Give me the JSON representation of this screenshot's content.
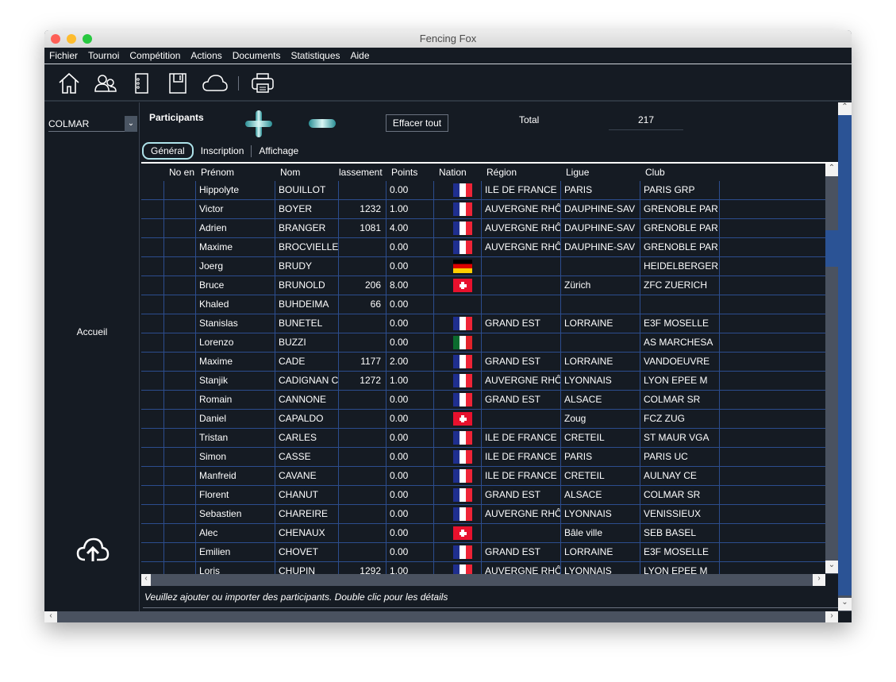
{
  "window": {
    "title": "Fencing Fox"
  },
  "menu": [
    "Fichier",
    "Tournoi",
    "Compétition",
    "Actions",
    "Documents",
    "Statistiques",
    "Aide"
  ],
  "toolbar": {
    "icons": [
      "home-icon",
      "users-icon",
      "notebook-icon",
      "save-icon",
      "cloud-icon",
      "print-icon"
    ]
  },
  "sidebar": {
    "selected": "COLMAR",
    "accueil": "Accueil",
    "upload_icon": "cloud-upload-icon"
  },
  "participants": {
    "title": "Participants",
    "add_icon": "plus-icon",
    "remove_icon": "minus-icon",
    "clear_all": "Effacer tout",
    "total_label": "Total",
    "total_value": "217"
  },
  "tabs": [
    "Général",
    "Inscription",
    "Affichage"
  ],
  "table": {
    "columns": [
      "No en",
      "Prénom",
      "Nom",
      "lassement",
      "Points",
      "Nation",
      "Région",
      "Ligue",
      "Club"
    ],
    "rows": [
      [
        "",
        "Hippolyte",
        "BOUILLOT",
        "",
        "0.00",
        "fr",
        "ILE DE FRANCE",
        "PARIS",
        "PARIS GRP"
      ],
      [
        "",
        "Victor",
        "BOYER",
        "1232",
        "1.00",
        "fr",
        "AUVERGNE RHÔ",
        "DAUPHINE-SAV",
        "GRENOBLE PAR"
      ],
      [
        "",
        "Adrien",
        "BRANGER",
        "1081",
        "4.00",
        "fr",
        "AUVERGNE RHÔ",
        "DAUPHINE-SAV",
        "GRENOBLE PAR"
      ],
      [
        "",
        "Maxime",
        "BROCVIELLE",
        "",
        "0.00",
        "fr",
        "AUVERGNE RHÔ",
        "DAUPHINE-SAV",
        "GRENOBLE PAR"
      ],
      [
        "",
        "Joerg",
        "BRUDY",
        "",
        "0.00",
        "de",
        "",
        "",
        "HEIDELBERGER"
      ],
      [
        "",
        "Bruce",
        "BRUNOLD",
        "206",
        "8.00",
        "ch",
        "",
        "Zürich",
        "ZFC ZUERICH"
      ],
      [
        "",
        "Khaled",
        "BUHDEIMA",
        "66",
        "0.00",
        "",
        "",
        "",
        ""
      ],
      [
        "",
        "Stanislas",
        "BUNETEL",
        "",
        "0.00",
        "fr",
        "GRAND EST",
        "LORRAINE",
        "E3F MOSELLE"
      ],
      [
        "",
        "Lorenzo",
        "BUZZI",
        "",
        "0.00",
        "it",
        "",
        "",
        "AS MARCHESA"
      ],
      [
        "",
        "Maxime",
        "CADE",
        "1177",
        "2.00",
        "fr",
        "GRAND EST",
        "LORRAINE",
        "VANDOEUVRE"
      ],
      [
        "",
        "Stanjik",
        "CADIGNAN C",
        "1272",
        "1.00",
        "fr",
        "AUVERGNE RHÔ",
        "LYONNAIS",
        "LYON EPEE M"
      ],
      [
        "",
        "Romain",
        "CANNONE",
        "",
        "0.00",
        "fr",
        "GRAND EST",
        "ALSACE",
        "COLMAR SR"
      ],
      [
        "",
        "Daniel",
        "CAPALDO",
        "",
        "0.00",
        "ch",
        "",
        "Zoug",
        "FCZ ZUG"
      ],
      [
        "",
        "Tristan",
        "CARLES",
        "",
        "0.00",
        "fr",
        "ILE DE FRANCE",
        "CRETEIL",
        "ST MAUR VGA"
      ],
      [
        "",
        "Simon",
        "CASSE",
        "",
        "0.00",
        "fr",
        "ILE DE FRANCE",
        "PARIS",
        "PARIS UC"
      ],
      [
        "",
        "Manfreid",
        "CAVANE",
        "",
        "0.00",
        "fr",
        "ILE DE FRANCE",
        "CRETEIL",
        "AULNAY CE"
      ],
      [
        "",
        "Florent",
        "CHANUT",
        "",
        "0.00",
        "fr",
        "GRAND EST",
        "ALSACE",
        "COLMAR SR"
      ],
      [
        "",
        "Sebastien",
        "CHAREIRE",
        "",
        "0.00",
        "fr",
        "AUVERGNE RHÔ",
        "LYONNAIS",
        "VENISSIEUX"
      ],
      [
        "",
        "Alec",
        "CHENAUX",
        "",
        "0.00",
        "ch",
        "",
        "Bâle ville",
        "SEB BASEL"
      ],
      [
        "",
        "Emilien",
        "CHOVET",
        "",
        "0.00",
        "fr",
        "GRAND EST",
        "LORRAINE",
        "E3F MOSELLE"
      ],
      [
        "",
        "Loris",
        "CHUPIN",
        "1292",
        "1.00",
        "fr",
        "AUVERGNE RHÔ",
        "LYONNAIS",
        "LYON EPEE M"
      ]
    ]
  },
  "status": "Veuillez ajouter ou importer des participants. Double clic pour les détails",
  "colors": {
    "background": "#151b23",
    "grid": "#2c4d8e",
    "scroll_thumb": "#2b5395",
    "accent": "#aee3ea"
  }
}
